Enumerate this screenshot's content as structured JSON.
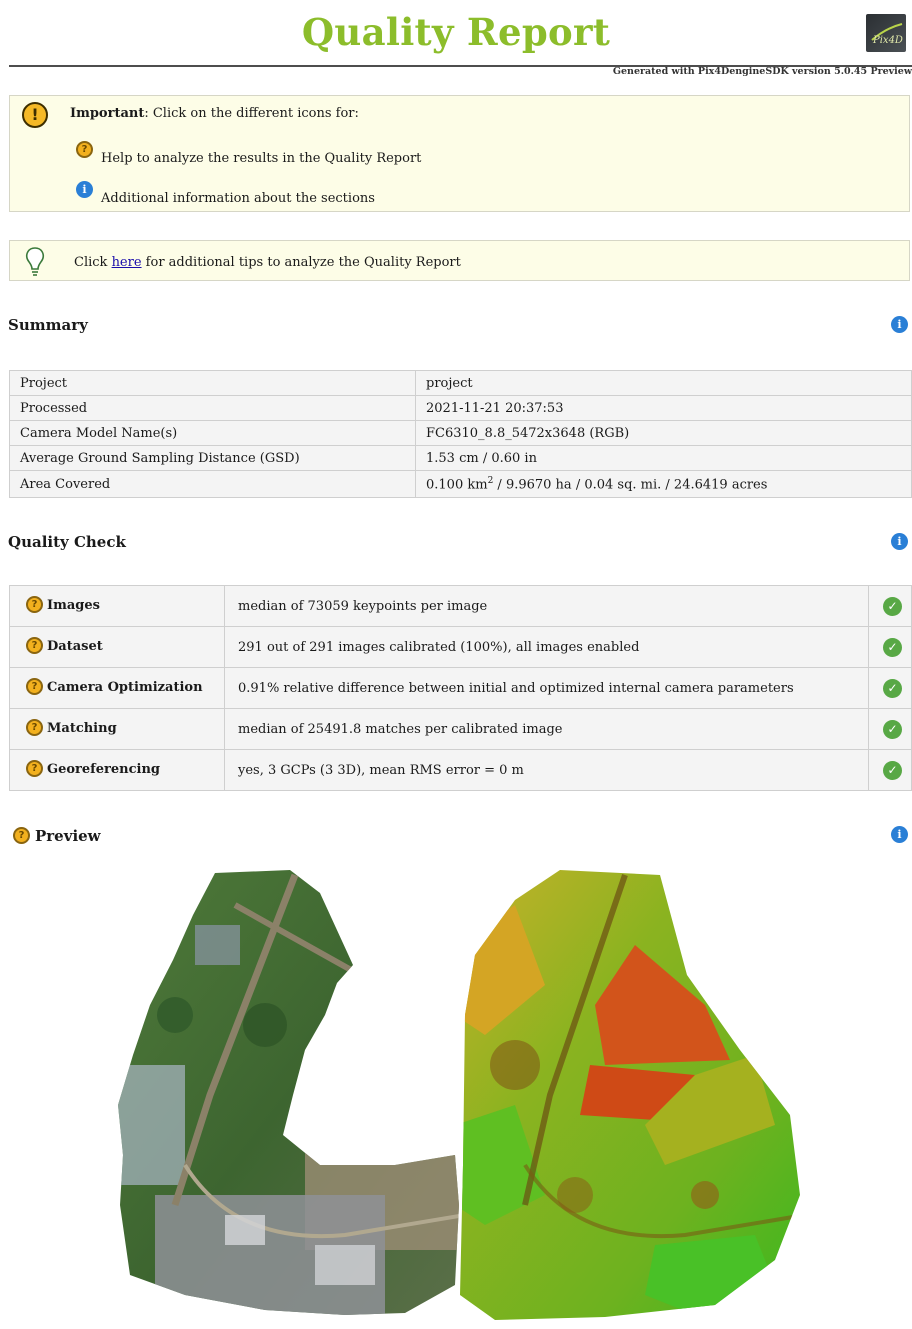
{
  "header": {
    "title": "Quality Report",
    "generated": "Generated with Pix4DengineSDK version 5.0.45 Preview",
    "logo_text": "Pix4D"
  },
  "important": {
    "lead": "Important",
    "text": ": Click on the different icons for:",
    "help_text": "Help to analyze the results in the Quality Report",
    "info_text": "Additional information about the sections"
  },
  "tip": {
    "before": "Click ",
    "link": "here",
    "after": " for additional tips to analyze the Quality Report"
  },
  "summary": {
    "heading": "Summary",
    "rows": [
      {
        "label": "Project",
        "value": "project"
      },
      {
        "label": "Processed",
        "value": "2021-11-21 20:37:53"
      },
      {
        "label": "Camera Model Name(s)",
        "value": "FC6310_8.8_5472x3648 (RGB)"
      },
      {
        "label": "Average Ground Sampling Distance (GSD)",
        "value": "1.53 cm / 0.60 in"
      },
      {
        "label": "Area Covered",
        "value_pre": "0.100 km",
        "value_sup": "2",
        "value_post": " / 9.9670 ha / 0.04 sq. mi. / 24.6419 acres"
      }
    ]
  },
  "quality_check": {
    "heading": "Quality Check",
    "rows": [
      {
        "name": "Images",
        "desc": "median of 73059 keypoints per image",
        "status": "ok"
      },
      {
        "name": "Dataset",
        "desc": "291 out of 291 images calibrated (100%), all images enabled",
        "status": "ok"
      },
      {
        "name": "Camera Optimization",
        "desc": "0.91% relative difference between initial and optimized internal camera parameters",
        "status": "ok"
      },
      {
        "name": "Matching",
        "desc": "median of 25491.8 matches per calibrated image",
        "status": "ok"
      },
      {
        "name": "Georeferencing",
        "desc": "yes, 3 GCPs (3 3D), mean RMS error = 0 m",
        "status": "ok"
      }
    ]
  },
  "preview": {
    "heading": "Preview"
  },
  "colors": {
    "title_green": "#8cbd2b",
    "box_bg": "#fdfde7",
    "ok_green": "#58a845",
    "info_blue": "#2a7fd6",
    "help_orange": "#f2b01e"
  }
}
